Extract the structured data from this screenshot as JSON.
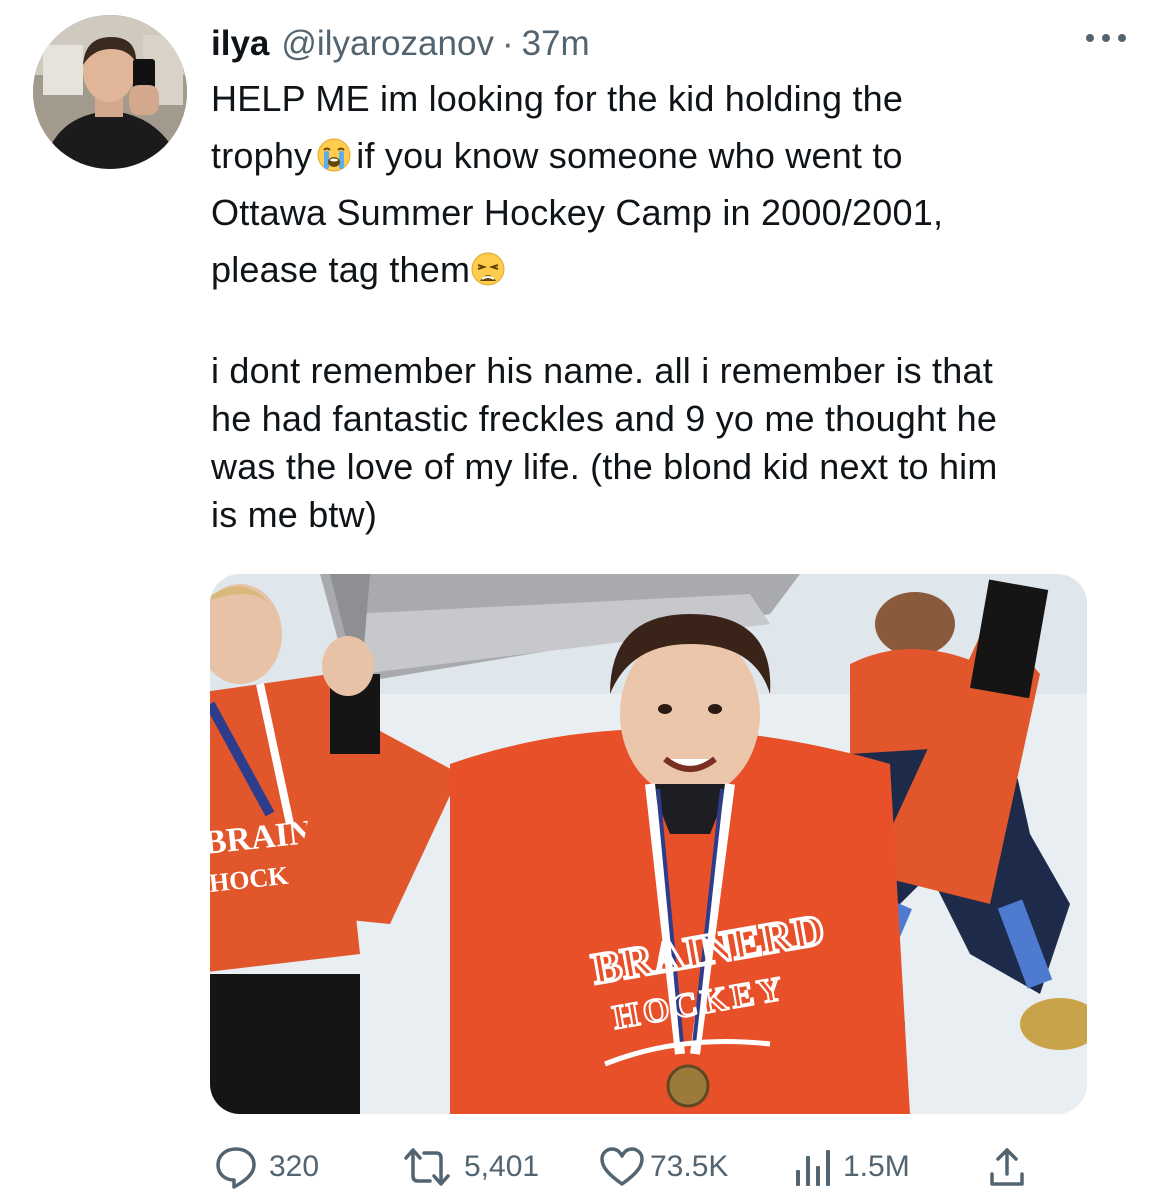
{
  "tweet": {
    "author": {
      "display_name": "ilya",
      "handle": "@ilyarozanov",
      "separator": "·",
      "time": "37m"
    },
    "text": {
      "line1": "HELP ME im looking for the kid holding the",
      "line2a": "trophy",
      "line2b": "if you know someone who went to",
      "line3": "Ottawa Summer Hockey  Camp in 2000/2001,",
      "line4": "please tag them",
      "para2_line1": "i dont remember his name. all i remember is that",
      "para2_line2": "he had fantastic freckles and 9 yo me thought he",
      "para2_line3": "was the love of my life. (the blond kid next to him",
      "para2_line4": "is me btw)"
    },
    "emojis": [
      "loudly-crying-face-emoji",
      "weary-face-emoji"
    ],
    "media": {
      "jersey_text_top": "BRAINERD",
      "jersey_text_bottom": "HOCKEY"
    },
    "stats": {
      "replies": "320",
      "retweets": "5,401",
      "likes": "73.5K",
      "views": "1.5M"
    },
    "icons": [
      "reply-icon",
      "retweet-icon",
      "like-icon",
      "views-icon",
      "share-icon",
      "more-icon"
    ],
    "colors": {
      "text": "#0f1419",
      "secondary": "#536471",
      "jersey": "#e8502a"
    }
  }
}
